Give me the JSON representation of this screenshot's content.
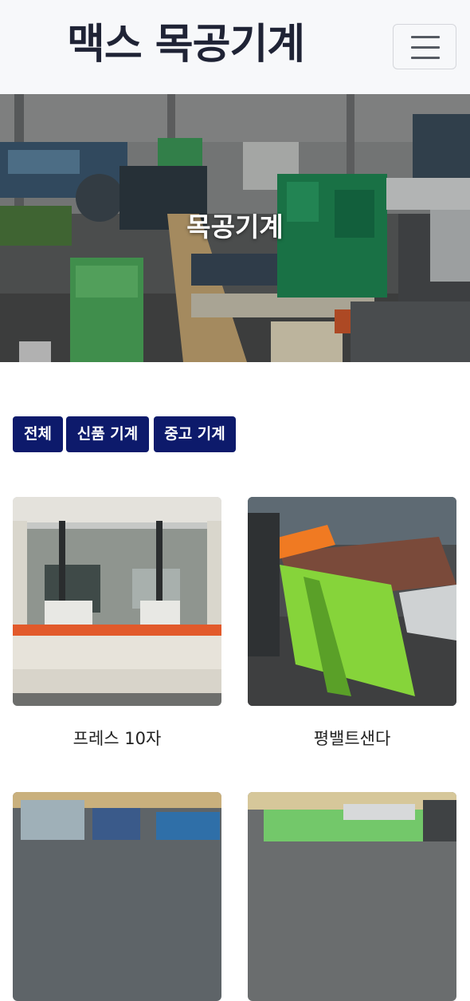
{
  "header": {
    "brand": "맥스 목공기계",
    "menu_icon": "hamburger-menu-icon"
  },
  "hero": {
    "title": "목공기계"
  },
  "filters": [
    {
      "label": "전체"
    },
    {
      "label": "신품 기계"
    },
    {
      "label": "중고 기계"
    }
  ],
  "products": [
    {
      "name": "프레스 10자"
    },
    {
      "name": "평밸트샌다"
    },
    {
      "name": ""
    },
    {
      "name": ""
    }
  ],
  "colors": {
    "navbar_bg": "#f7f8fa",
    "brand_text": "#1f2335",
    "filter_bg": "#0d1a6b",
    "filter_text": "#ffffff"
  }
}
